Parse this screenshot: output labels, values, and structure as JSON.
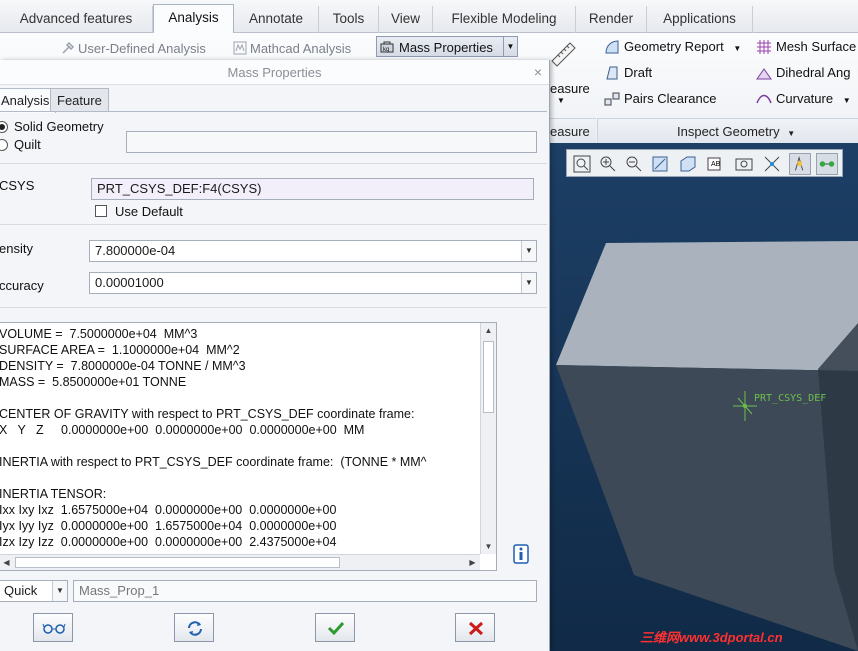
{
  "ribbon": {
    "tabs": [
      "Advanced features",
      "Analysis",
      "Annotate",
      "Tools",
      "View",
      "Flexible Modeling",
      "Render",
      "Applications"
    ],
    "sub_items": {
      "user_defined": "User-Defined Analysis",
      "mathcad": "Mathcad Analysis",
      "mass_properties": "Mass Properties"
    },
    "measure_label": "easure",
    "measure_footer": "easure",
    "inspect": {
      "geometry_report": "Geometry Report",
      "mesh_surface": "Mesh Surface",
      "draft": "Draft",
      "dihedral": "Dihedral Ang",
      "pairs_clearance": "Pairs Clearance",
      "curvature": "Curvature",
      "footer": "Inspect Geometry"
    }
  },
  "dialog": {
    "title": "Mass Properties",
    "close": "×",
    "tabs": [
      "Analysis",
      "Feature"
    ],
    "geometry_options": [
      "Solid Geometry",
      "Quilt"
    ],
    "selected_geometry": "Solid Geometry",
    "csys_label": "CSYS",
    "csys_value": "PRT_CSYS_DEF:F4(CSYS)",
    "use_default_label": "Use Default",
    "use_default_checked": false,
    "density_label": "ensity",
    "density_value": "7.800000e-04",
    "accuracy_label": "ccuracy",
    "accuracy_value": "0.00001000",
    "results": [
      "VOLUME =  7.5000000e+04  MM^3",
      "SURFACE AREA =  1.1000000e+04  MM^2",
      "DENSITY =  7.8000000e-04 TONNE / MM^3",
      "MASS =  5.8500000e+01 TONNE",
      "",
      "CENTER OF GRAVITY with respect to PRT_CSYS_DEF coordinate frame:",
      "X   Y   Z     0.0000000e+00  0.0000000e+00  0.0000000e+00  MM",
      "",
      "INERTIA with respect to PRT_CSYS_DEF coordinate frame:  (TONNE * MM^",
      "",
      "INERTIA TENSOR:",
      "Ixx Ixy Ixz  1.6575000e+04  0.0000000e+00  0.0000000e+00",
      "Iyx Iyy Iyz  0.0000000e+00  1.6575000e+04  0.0000000e+00",
      "Izx Izy Izz  0.0000000e+00  0.0000000e+00  2.4375000e+04"
    ],
    "mode_value": "Quick",
    "analysis_name": "Mass_Prop_1"
  },
  "graphics": {
    "csys_label": "PRT_CSYS_DEF",
    "watermark": "三维网www.3dportal.cn"
  },
  "colors": {
    "viewport_bg": "#1a3a5e",
    "csys_green": "#6cc04a",
    "ok_green": "#2e9a2e",
    "cancel_red": "#cc1a1a"
  }
}
